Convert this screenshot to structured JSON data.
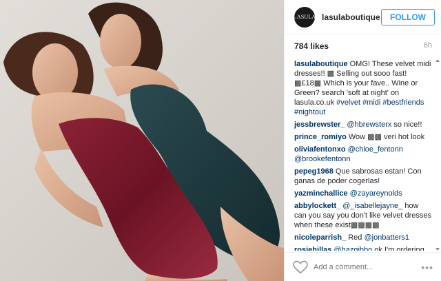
{
  "post": {
    "username": "lasulaboutique",
    "avatar_text": "LASULA",
    "follow_label": "FOLLOW",
    "likes": "784 likes",
    "time": "6h",
    "add_comment_placeholder": "Add a comment...",
    "more_label": "•••"
  },
  "comments": [
    {
      "user": "lasulaboutique",
      "text": "OMG! These velvet midi dresses!! ▩ Selling out sooo fast! ▩£18▩ Which is your fave.. Wine or Green? search 'soft at night' on lasula.co.uk",
      "tags": "#velvet #midi #bestfriends #nightout"
    },
    {
      "user": "jessbrewster_",
      "text": "",
      "tags": "@hbrewsterx",
      "after": " so nice!!"
    },
    {
      "user": "prince_romiyo",
      "text": "Wow ▩▩ veri hot look",
      "tags": ""
    },
    {
      "user": "oliviafentonxo",
      "text": "",
      "tags": "@chloe_fentonn @brookefentonn"
    },
    {
      "user": "pepeg1968",
      "text": "Que sabrosas estan! Con ganas de poder cogerlas!",
      "tags": ""
    },
    {
      "user": "yazminchallice",
      "text": "",
      "tags": "@zayareynolds"
    },
    {
      "user": "abbylockett_",
      "text": "",
      "tags": "@_isabellejayne_",
      "after": " how can you say you don't like velvet dresses when these exist▩▩▩▩"
    },
    {
      "user": "nicoleparrish_",
      "text": "Red ",
      "tags": "@jonbatters1"
    },
    {
      "user": "rosiehillas",
      "text": "",
      "tags": "@hazgibbo",
      "after": " ok I'm ordering this Friday, I've decided"
    }
  ],
  "colors": {
    "accent": "#3897f0",
    "username": "#003569",
    "wine_dress": "#7a1a2c",
    "green_dress": "#1f3b3f"
  }
}
